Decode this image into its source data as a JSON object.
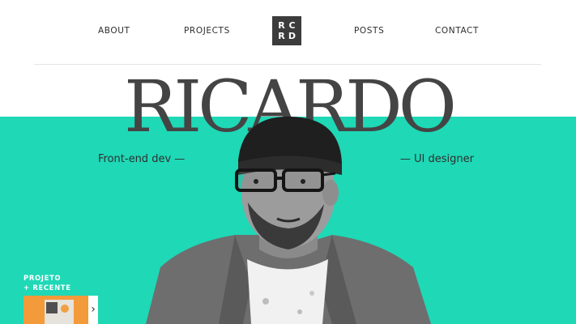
{
  "nav": {
    "about": "ABOUT",
    "projects": "PROJECTS",
    "posts": "POSTS",
    "contact": "CONTACT"
  },
  "logo": {
    "letters": [
      "R",
      "C",
      "R",
      "D"
    ]
  },
  "hero": {
    "name": "RICARDO",
    "tag_left": "Front-end dev —",
    "tag_right": "— UI designer"
  },
  "recent": {
    "line1": "PROJETO",
    "line2": "+ RECENTE",
    "arrow": "›"
  },
  "colors": {
    "accent": "#1ed8b6",
    "text": "#444444",
    "card": "#f39a3b"
  }
}
